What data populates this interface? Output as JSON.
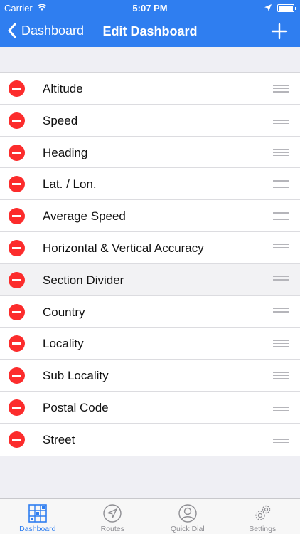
{
  "status": {
    "carrier": "Carrier",
    "time": "5:07 PM"
  },
  "nav": {
    "back_label": "Dashboard",
    "title": "Edit Dashboard"
  },
  "items": [
    {
      "label": "Altitude"
    },
    {
      "label": "Speed"
    },
    {
      "label": "Heading"
    },
    {
      "label": "Lat. / Lon."
    },
    {
      "label": "Average Speed"
    },
    {
      "label": "Horizontal & Vertical Accuracy"
    },
    {
      "label": "Section Divider"
    },
    {
      "label": "Country"
    },
    {
      "label": "Locality"
    },
    {
      "label": "Sub Locality"
    },
    {
      "label": "Postal Code"
    },
    {
      "label": "Street"
    }
  ],
  "tabs": [
    {
      "label": "Dashboard",
      "icon": "dashboard-icon",
      "active": true
    },
    {
      "label": "Routes",
      "icon": "navigation-arrow-icon",
      "active": false
    },
    {
      "label": "Quick Dial",
      "icon": "person-icon",
      "active": false
    },
    {
      "label": "Settings",
      "icon": "gears-icon",
      "active": false
    }
  ],
  "colors": {
    "accent": "#2f7ef0",
    "delete": "#fc2c2c",
    "background": "#efeff4"
  }
}
